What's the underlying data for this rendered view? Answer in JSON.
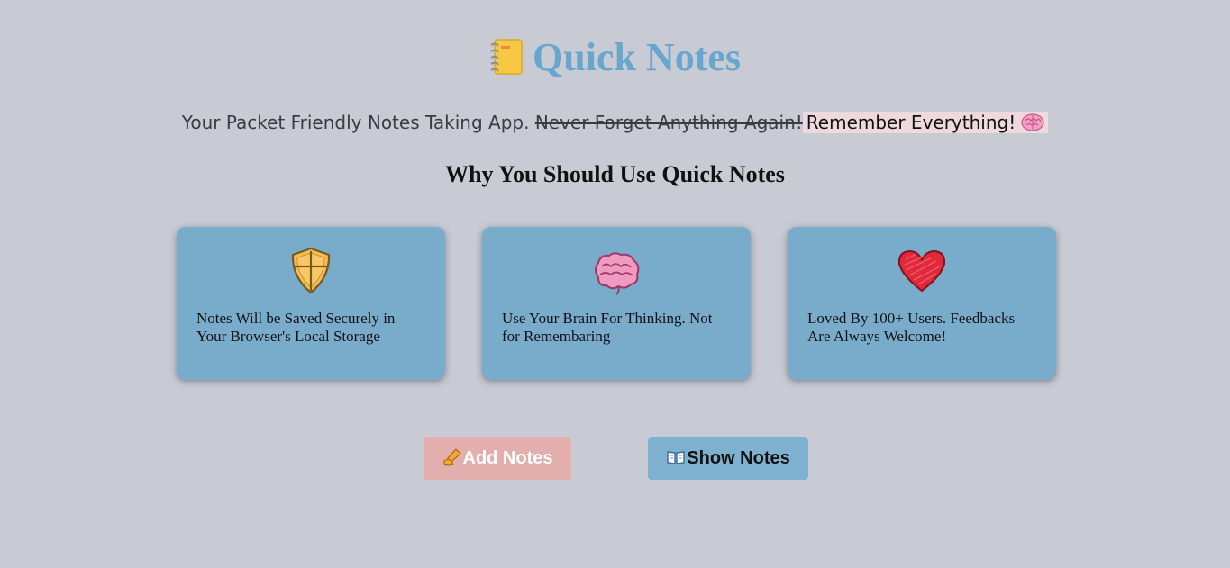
{
  "header": {
    "logo_icon": "notebook-icon",
    "title": "Quick Notes"
  },
  "tagline": {
    "intro": "Your Packet Friendly Notes Taking App.",
    "struck": "Never Forget Anything Again!",
    "highlight": "Remember Everything!",
    "highlight_icon": "brain-icon"
  },
  "section": {
    "heading": "Why You Should Use Quick Notes"
  },
  "features": [
    {
      "icon": "shield-icon",
      "text": "Notes Will be Saved Securely in Your Browser's Local Storage"
    },
    {
      "icon": "brain-icon",
      "text": "Use Your Brain For Thinking. Not for Remembaring"
    },
    {
      "icon": "heart-icon",
      "text": "Loved By 100+ Users. Feedbacks Are Always Welcome!"
    }
  ],
  "actions": {
    "add_label": "Add Notes",
    "add_icon": "writing-hand-icon",
    "show_label": "Show Notes",
    "show_icon": "open-book-icon"
  },
  "colors": {
    "background": "#c9cbd4",
    "title": "#68a6cd",
    "card": "#79abcb",
    "add_button": "#e3aeae",
    "show_button": "#7eb1d0",
    "highlight": "#eed9dd"
  }
}
